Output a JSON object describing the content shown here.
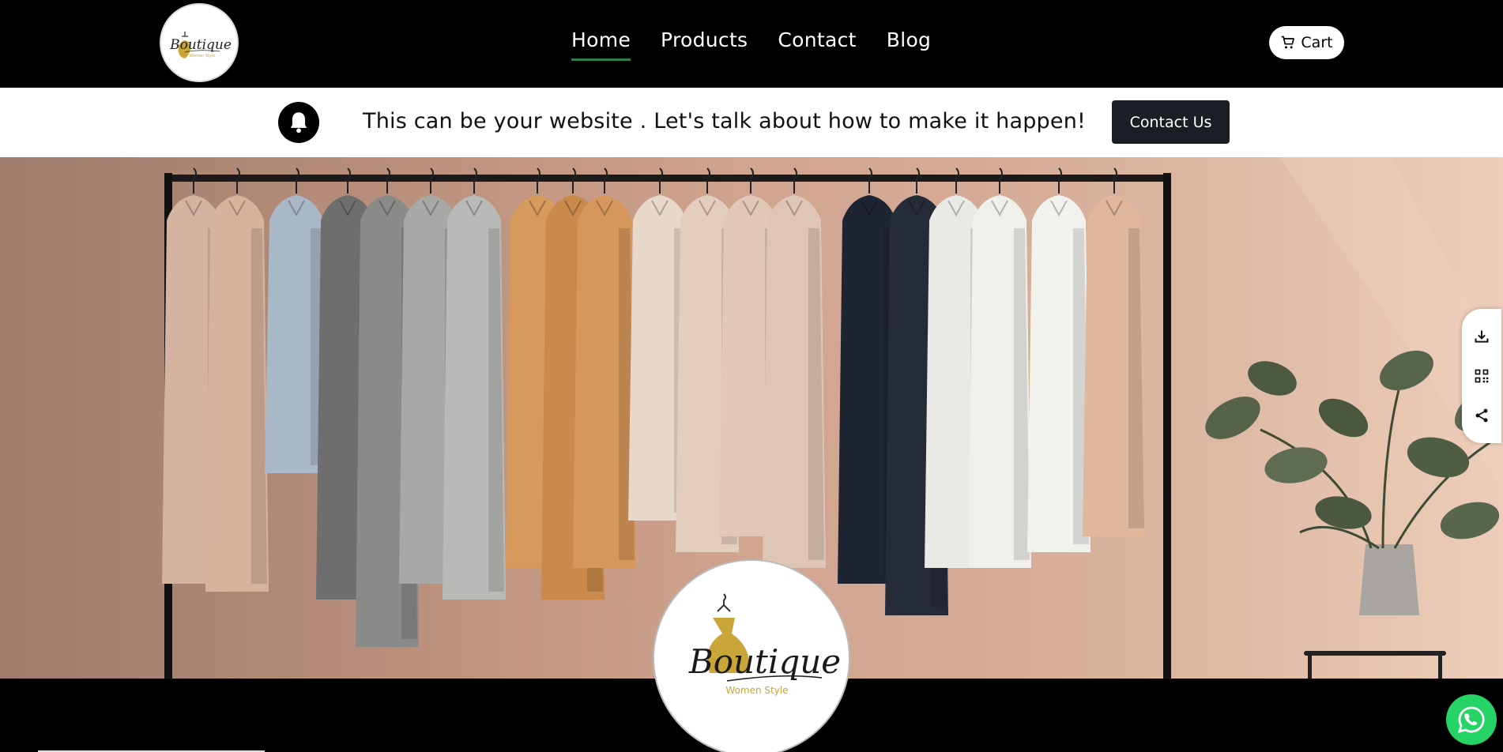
{
  "brand": {
    "logo_text": "Boutique",
    "logo_tagline": "Women Style",
    "logo_color": "#caa53a"
  },
  "nav": {
    "items": [
      {
        "label": "Home",
        "active": true
      },
      {
        "label": "Products",
        "active": false
      },
      {
        "label": "Contact",
        "active": false
      },
      {
        "label": "Blog",
        "active": false
      }
    ],
    "active_underline_color": "#2e7d4f"
  },
  "cart": {
    "label": "Cart",
    "icon": "cart-icon"
  },
  "notice": {
    "icon": "bell-icon",
    "text": "This can be your website . Let's talk about how to make it happen!",
    "button_label": "Contact Us"
  },
  "hero": {
    "image": "clothes-rack-with-jackets-and-plant"
  },
  "side_tools": {
    "icons": [
      "download-icon",
      "qr-code-icon",
      "share-icon"
    ]
  },
  "whatsapp": {
    "icon": "whatsapp-icon",
    "color": "#25d366"
  }
}
